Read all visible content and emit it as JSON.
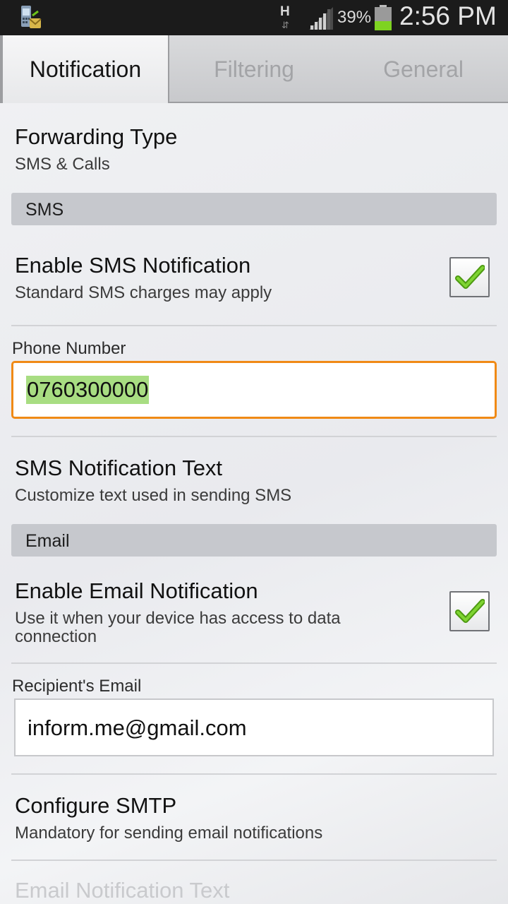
{
  "status_bar": {
    "network_type": "H",
    "battery_percent": "39%",
    "battery_level": 0.39,
    "time": "2:56 PM",
    "app_icon": "phone-notification-app-icon"
  },
  "tabs": [
    {
      "label": "Notification",
      "active": true
    },
    {
      "label": "Filtering",
      "active": false
    },
    {
      "label": "General",
      "active": false
    }
  ],
  "forwarding_type": {
    "title": "Forwarding Type",
    "summary": "SMS & Calls"
  },
  "sms_section": {
    "header": "SMS",
    "enable": {
      "title": "Enable SMS Notification",
      "summary": "Standard SMS charges may apply",
      "checked": true
    },
    "phone": {
      "label": "Phone Number",
      "value": "0760300000"
    },
    "text": {
      "title": "SMS Notification Text",
      "summary": "Customize text used in sending SMS"
    }
  },
  "email_section": {
    "header": "Email",
    "enable": {
      "title": "Enable Email Notification",
      "summary": "Use it when your device has access to data connection",
      "checked": true
    },
    "recipient": {
      "label": "Recipient's Email",
      "value": "inform.me@gmail.com"
    },
    "smtp": {
      "title": "Configure SMTP",
      "summary": "Mandatory for sending email notifications"
    },
    "text_title": "Email Notification Text"
  },
  "colors": {
    "focus_border": "#f08a16",
    "selection": "#a8dd82",
    "check_green": "#6cc21a",
    "battery_fill": "#7ed321"
  }
}
